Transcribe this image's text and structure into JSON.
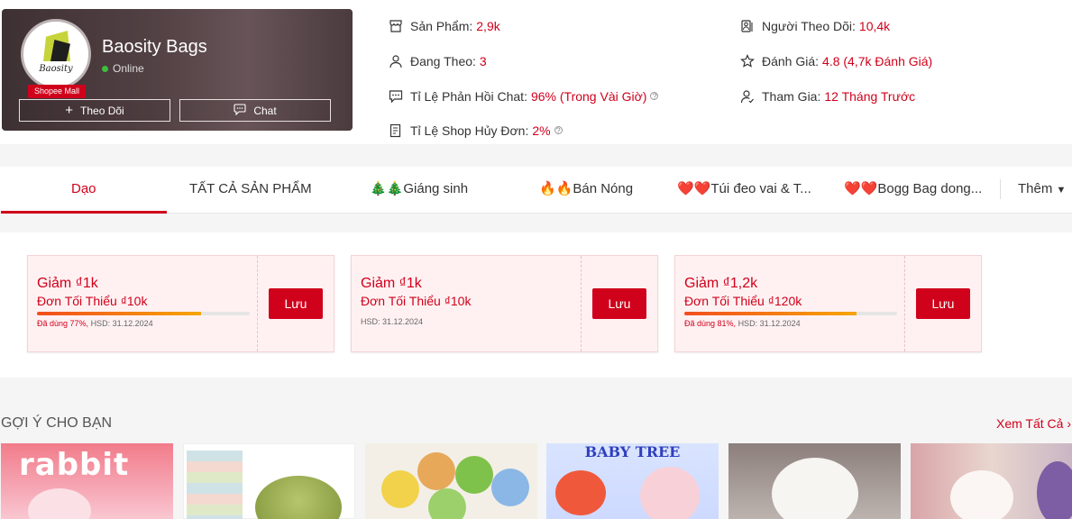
{
  "shop": {
    "name": "Baosity Bags",
    "status": "Online",
    "logo_text": "Baosity",
    "badge": "Shopee Mall",
    "follow_label": "Theo Dõi",
    "chat_label": "Chat"
  },
  "stats": {
    "products_label": "Sản Phẩm:",
    "products_value": "2,9k",
    "followers_label": "Người Theo Dõi:",
    "followers_value": "10,4k",
    "following_label": "Đang Theo:",
    "following_value": "3",
    "rating_label": "Đánh Giá:",
    "rating_value": "4.8 (4,7k Đánh Giá)",
    "chat_response_label": "Tỉ Lệ Phản Hồi Chat:",
    "chat_response_value": "96% (Trong Vài Giờ)",
    "joined_label": "Tham Gia:",
    "joined_value": "12 Tháng Trước",
    "cancel_rate_label": "Tỉ Lệ Shop Hủy Đơn:",
    "cancel_rate_value": "2%"
  },
  "tabs": [
    {
      "label": "Dạo"
    },
    {
      "label": "TẤT CẢ SẢN PHẨM"
    },
    {
      "label": "🎄🎄Giáng sinh"
    },
    {
      "label": "🔥🔥Bán Nóng"
    },
    {
      "label": "❤️❤️Túi đeo vai & T..."
    },
    {
      "label": "❤️❤️Bogg Bag dong..."
    }
  ],
  "more_tab": "Thêm",
  "vouchers": [
    {
      "title": "Giảm ₫1k",
      "minimum": "Đơn Tối Thiểu ₫10k",
      "used": "Đã dùng 77%,",
      "expiry": "HSD: 31.12.2024",
      "used_fraction": 0.77,
      "save_label": "Lưu"
    },
    {
      "title": "Giảm ₫1k",
      "minimum": "Đơn Tối Thiểu ₫10k",
      "used": "",
      "expiry": "HSD: 31.12.2024",
      "used_fraction": null,
      "save_label": "Lưu"
    },
    {
      "title": "Giảm ₫1,2k",
      "minimum": "Đơn Tối Thiểu ₫120k",
      "used": "Đã dùng 81%,",
      "expiry": "HSD: 31.12.2024",
      "used_fraction": 0.81,
      "save_label": "Lưu"
    }
  ],
  "recommend": {
    "title": "GỢI Ý CHO BẠN",
    "see_all": "Xem Tất Cả ›",
    "product1_text": "rabbit",
    "product4_text": "BABY TREE"
  },
  "colors": {
    "accent": "#d0011b",
    "voucher_bg": "#fff1f2"
  }
}
